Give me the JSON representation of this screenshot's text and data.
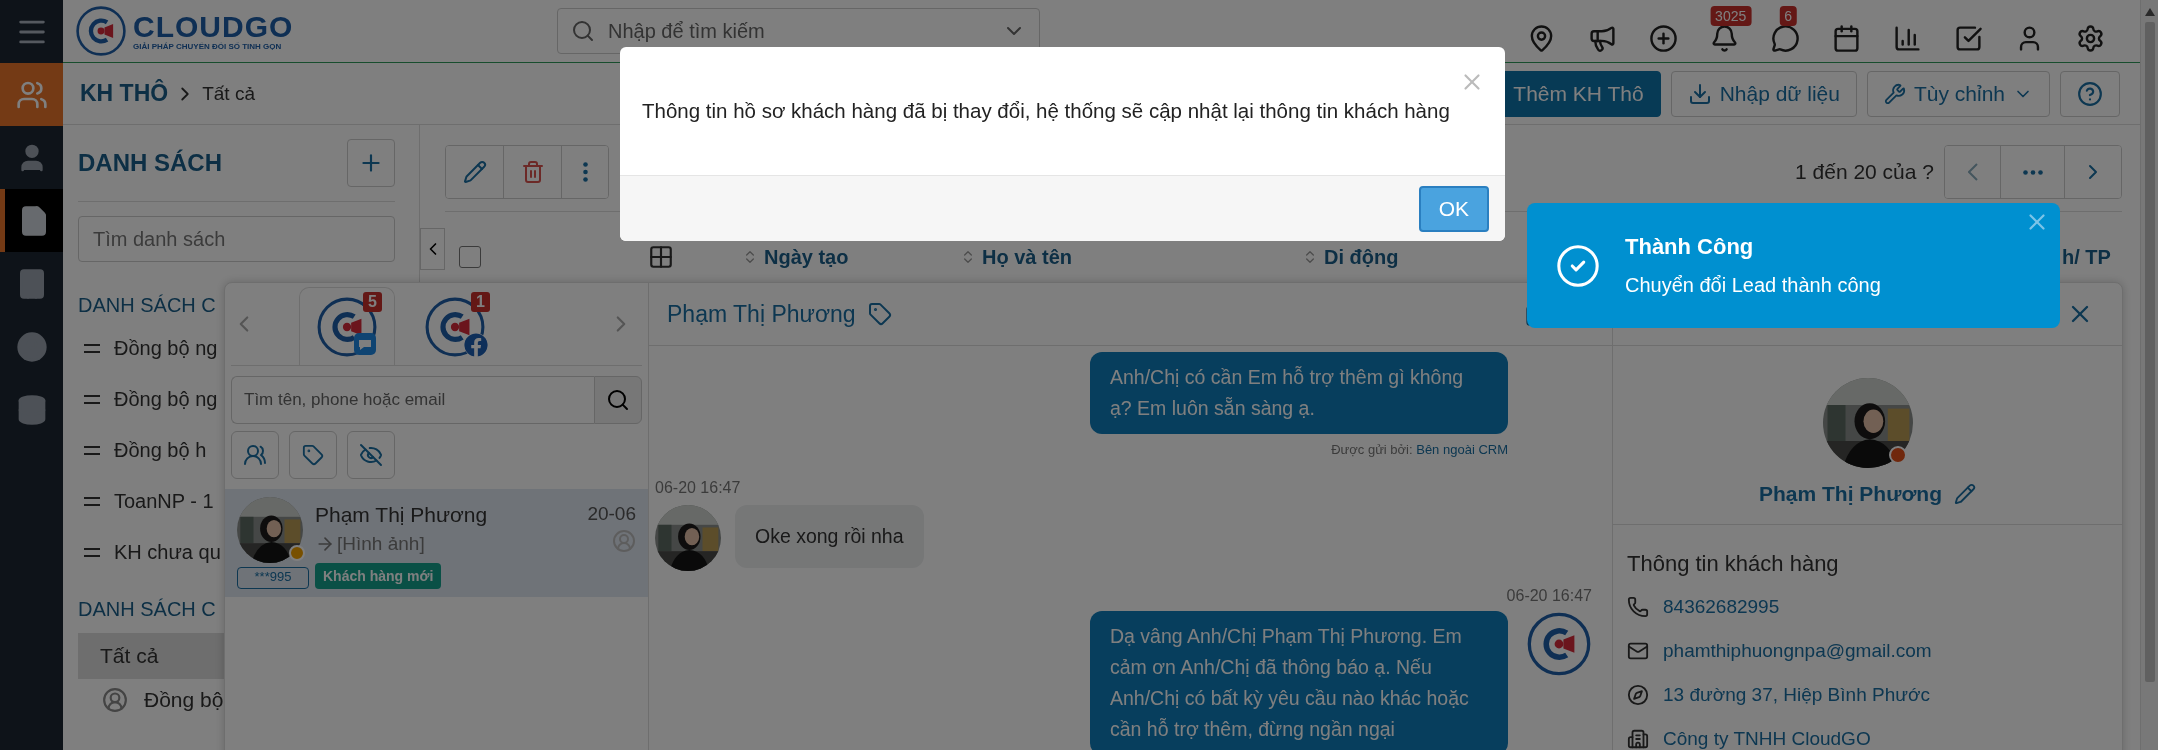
{
  "topbar": {
    "logo": {
      "name": "CLOUDGO",
      "tagline": "GIẢI PHÁP CHUYỂN ĐỔI SỐ TINH GỌN"
    },
    "search": {
      "placeholder": "Nhập để tìm kiếm"
    },
    "badges": [
      "3025",
      "6"
    ]
  },
  "rail": [
    {
      "kind": "module"
    },
    {
      "kind": "item",
      "selected": false
    },
    {
      "kind": "item",
      "selected": true
    },
    {
      "kind": "item",
      "selected": false
    },
    {
      "kind": "item",
      "selected": false
    },
    {
      "kind": "item",
      "selected": false
    }
  ],
  "breadcrumb": {
    "module": "KH THÔ",
    "current": "Tất cả"
  },
  "actions": [
    {
      "kind": "primary",
      "label": "Thêm KH Thô"
    },
    {
      "kind": "import",
      "label": "Nhập dữ liệu"
    },
    {
      "kind": "dropdown",
      "label": "Tùy chỉnh"
    },
    {
      "kind": "help"
    }
  ],
  "lists": {
    "title": "DANH SÁCH",
    "search": {
      "placeholder": "Tìm danh sách"
    },
    "sections": [
      {
        "title": "DANH SÁCH C",
        "items": [
          {
            "label": "Đồng bộ ng"
          },
          {
            "label": "Đồng bộ ng"
          },
          {
            "label": "Đồng bộ h"
          },
          {
            "label": "ToanNP - 1"
          },
          {
            "label": "KH chưa qu"
          }
        ]
      }
    ],
    "section_2": {
      "title": "DANH SÁCH C",
      "filters": [
        {
          "label": "Tất cả",
          "selected": true
        }
      ],
      "items": [
        {
          "label": "Đồng bộ"
        }
      ]
    }
  },
  "table": {
    "select_all": {
      "checked": false
    },
    "pager": {
      "range": "1 đến 20 của",
      "help": "?"
    },
    "columns": [
      "Ngày tạo",
      "Họ và tên",
      "Di động",
      "h/ TP"
    ]
  },
  "chat": {
    "accounts": [
      {
        "kind": "zalo",
        "badge": "5",
        "selected": true
      },
      {
        "kind": "facebook",
        "badge": "1",
        "selected": false
      }
    ],
    "search": {
      "placeholder": "Tìm tên, phone hoặc email"
    },
    "conversations": [
      {
        "name": "Phạm Thị Phương",
        "date": "20-06",
        "preview": "[Hình ảnh]",
        "phone": "***995",
        "tag": "Khách hàng mới",
        "selected": true
      }
    ],
    "header": {
      "name": "Phạm Thị Phương"
    },
    "messages": [
      {
        "kind": "out",
        "text": "Anh/Chị có cần Em hỗ trợ thêm gì không ạ? Em luôn sẵn sàng ạ.",
        "sent_by_label": "Được gửi bởi:",
        "sent_by": "Bên ngoài CRM"
      },
      {
        "kind": "in",
        "time": "06-20 16:47",
        "text": "Oke xong rồi nha"
      },
      {
        "kind": "out",
        "time": "06-20 16:47",
        "text": "Dạ vâng Anh/Chị Phạm Thị Phương. Em cảm ơn Anh/Chị đã thông báo ạ. Nếu Anh/Chị có bất kỳ yêu cầu nào khác hoặc cần hỗ trợ thêm, đừng ngần ngại"
      }
    ],
    "profile": {
      "name": "Phạm Thị Phương",
      "section": "Thông tin khách hàng",
      "fields": [
        {
          "kind": "phone",
          "value": "84362682995"
        },
        {
          "kind": "email",
          "value": "phamthiphuongnpa@gmail.com"
        },
        {
          "kind": "address",
          "value": "13 đường 37, Hiệp Bình Phước"
        },
        {
          "kind": "company",
          "value": "Công ty TNHH CloudGO"
        }
      ]
    }
  },
  "modal": {
    "message": "Thông tin hồ sơ khách hàng đã bị thay đổi, hệ thống sẽ cập nhật lại thông tin khách hàng",
    "button": "OK"
  },
  "toast": {
    "title": "Thành Công",
    "message": "Chuyển đổi Lead thành công"
  }
}
